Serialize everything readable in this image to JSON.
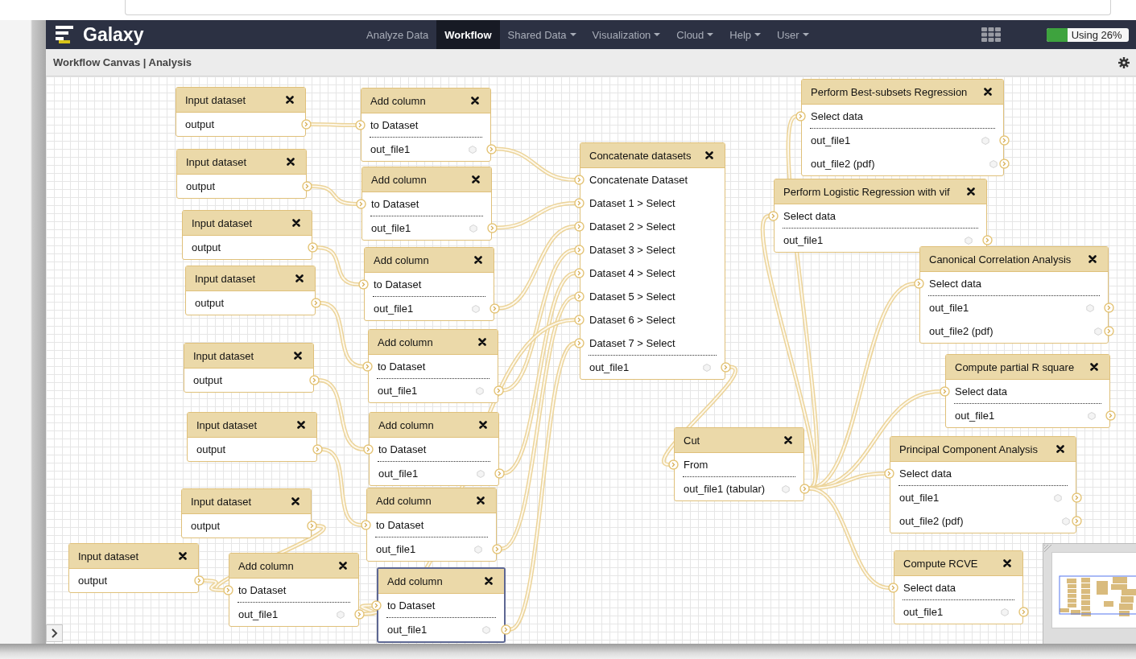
{
  "masthead": {
    "brand": "Galaxy",
    "nav": [
      {
        "label": "Analyze Data",
        "selected": false,
        "dropdown": false
      },
      {
        "label": "Workflow",
        "selected": true,
        "dropdown": false
      },
      {
        "label": "Shared Data",
        "selected": false,
        "dropdown": true
      },
      {
        "label": "Visualization",
        "selected": false,
        "dropdown": true
      },
      {
        "label": "Cloud",
        "selected": false,
        "dropdown": true
      },
      {
        "label": "Help",
        "selected": false,
        "dropdown": true
      },
      {
        "label": "User",
        "selected": false,
        "dropdown": true
      }
    ],
    "quota": {
      "label": "Using 26%",
      "level": 0.26
    }
  },
  "toolbar": {
    "title": "Workflow Canvas | Analysis"
  },
  "canvas": {
    "nodes": [
      {
        "kind": "input",
        "title": "Input dataset",
        "selected": false,
        "rows": [
          {
            "kind": "output",
            "label": "output"
          }
        ]
      },
      {
        "kind": "input",
        "title": "Input dataset",
        "selected": false,
        "rows": [
          {
            "kind": "output",
            "label": "output"
          }
        ]
      },
      {
        "kind": "tool",
        "title": "Add column",
        "selected": false,
        "rows": [
          {
            "kind": "input",
            "label": "to Dataset"
          },
          {
            "kind": "output",
            "label": "out_file1"
          }
        ]
      },
      {
        "kind": "input",
        "title": "Input dataset",
        "selected": false,
        "rows": [
          {
            "kind": "output",
            "label": "output"
          }
        ]
      },
      {
        "kind": "tool",
        "title": "Add column",
        "selected": false,
        "rows": [
          {
            "kind": "input",
            "label": "to Dataset"
          },
          {
            "kind": "output",
            "label": "out_file1"
          }
        ]
      },
      {
        "kind": "input",
        "title": "Input dataset",
        "selected": false,
        "rows": [
          {
            "kind": "output",
            "label": "output"
          }
        ]
      },
      {
        "kind": "tool",
        "title": "Add column",
        "selected": false,
        "rows": [
          {
            "kind": "input",
            "label": "to Dataset"
          },
          {
            "kind": "output",
            "label": "out_file1"
          }
        ]
      },
      {
        "kind": "input",
        "title": "Input dataset",
        "selected": false,
        "rows": [
          {
            "kind": "output",
            "label": "output"
          }
        ]
      },
      {
        "kind": "tool",
        "title": "Add column",
        "selected": false,
        "rows": [
          {
            "kind": "input",
            "label": "to Dataset"
          },
          {
            "kind": "output",
            "label": "out_file1"
          }
        ]
      },
      {
        "kind": "input",
        "title": "Input dataset",
        "selected": false,
        "rows": [
          {
            "kind": "output",
            "label": "output"
          }
        ]
      },
      {
        "kind": "tool",
        "title": "Add column",
        "selected": false,
        "rows": [
          {
            "kind": "input",
            "label": "to Dataset"
          },
          {
            "kind": "output",
            "label": "out_file1"
          }
        ]
      },
      {
        "kind": "input",
        "title": "Input dataset",
        "selected": false,
        "rows": [
          {
            "kind": "output",
            "label": "output"
          }
        ]
      },
      {
        "kind": "input",
        "title": "Input dataset",
        "selected": false,
        "rows": [
          {
            "kind": "output",
            "label": "output"
          }
        ]
      },
      {
        "kind": "tool",
        "title": "Add column",
        "selected": false,
        "rows": [
          {
            "kind": "input",
            "label": "to Dataset"
          },
          {
            "kind": "output",
            "label": "out_file1"
          }
        ]
      },
      {
        "kind": "tool",
        "title": "Add column",
        "selected": false,
        "rows": [
          {
            "kind": "input",
            "label": "to Dataset"
          },
          {
            "kind": "output",
            "label": "out_file1"
          }
        ]
      },
      {
        "kind": "tool",
        "title": "Add column",
        "selected": true,
        "rows": [
          {
            "kind": "input",
            "label": "to Dataset"
          },
          {
            "kind": "output",
            "label": "out_file1"
          }
        ]
      },
      {
        "kind": "tool",
        "title": "Concatenate datasets",
        "selected": false,
        "rows": [
          {
            "kind": "input",
            "label": "Concatenate Dataset"
          },
          {
            "kind": "input",
            "label": "Dataset 1 > Select"
          },
          {
            "kind": "input",
            "label": "Dataset 2 > Select"
          },
          {
            "kind": "input",
            "label": "Dataset 3 > Select"
          },
          {
            "kind": "input",
            "label": "Dataset 4 > Select"
          },
          {
            "kind": "input",
            "label": "Dataset 5 > Select"
          },
          {
            "kind": "input",
            "label": "Dataset 6 > Select"
          },
          {
            "kind": "input",
            "label": "Dataset 7 > Select"
          },
          {
            "kind": "output",
            "label": "out_file1"
          }
        ]
      },
      {
        "kind": "tool",
        "title": "Cut",
        "selected": false,
        "rows": [
          {
            "kind": "input",
            "label": "From"
          },
          {
            "kind": "output",
            "label": "out_file1 (tabular)"
          }
        ]
      },
      {
        "kind": "tool",
        "title": "Perform Best-subsets Regression",
        "selected": false,
        "rows": [
          {
            "kind": "input",
            "label": "Select data"
          },
          {
            "kind": "output",
            "label": "out_file1"
          },
          {
            "kind": "output",
            "label": "out_file2 (pdf)"
          }
        ]
      },
      {
        "kind": "tool",
        "title": "Perform Logistic Regression with vif",
        "selected": false,
        "rows": [
          {
            "kind": "input",
            "label": "Select data"
          },
          {
            "kind": "output",
            "label": "out_file1"
          }
        ]
      },
      {
        "kind": "tool",
        "title": "Canonical Correlation Analysis",
        "selected": false,
        "rows": [
          {
            "kind": "input",
            "label": "Select data"
          },
          {
            "kind": "output",
            "label": "out_file1"
          },
          {
            "kind": "output",
            "label": "out_file2 (pdf)"
          }
        ]
      },
      {
        "kind": "tool",
        "title": "Compute partial R square",
        "selected": false,
        "rows": [
          {
            "kind": "input",
            "label": "Select data"
          },
          {
            "kind": "output",
            "label": "out_file1"
          }
        ]
      },
      {
        "kind": "tool",
        "title": "Principal Component Analysis",
        "selected": false,
        "rows": [
          {
            "kind": "input",
            "label": "Select data"
          },
          {
            "kind": "output",
            "label": "out_file1"
          },
          {
            "kind": "output",
            "label": "out_file2 (pdf)"
          }
        ]
      },
      {
        "kind": "tool",
        "title": "Compute RCVE",
        "selected": false,
        "rows": [
          {
            "kind": "input",
            "label": "Select data"
          },
          {
            "kind": "output",
            "label": "out_file1"
          }
        ]
      }
    ]
  }
}
